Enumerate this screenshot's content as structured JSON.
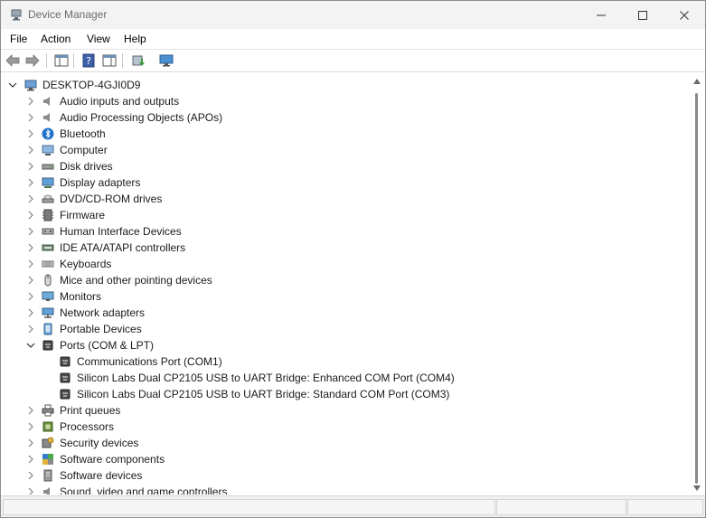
{
  "window": {
    "title": "Device Manager"
  },
  "menu": {
    "items": [
      "File",
      "Action",
      "View",
      "Help"
    ]
  },
  "toolbar": {
    "buttons": [
      "back-icon",
      "forward-icon",
      "properties-view-icon",
      "help-icon",
      "console-tree-icon",
      "update-driver-icon",
      "scan-hardware-icon"
    ]
  },
  "tree": {
    "root": "DESKTOP-4GJI0D9",
    "categories": [
      "Audio inputs and outputs",
      "Audio Processing Objects (APOs)",
      "Bluetooth",
      "Computer",
      "Disk drives",
      "Display adapters",
      "DVD/CD-ROM drives",
      "Firmware",
      "Human Interface Devices",
      "IDE ATA/ATAPI controllers",
      "Keyboards",
      "Mice and other pointing devices",
      "Monitors",
      "Network adapters",
      "Portable Devices",
      "Ports (COM & LPT)",
      "Print queues",
      "Processors",
      "Security devices",
      "Software components",
      "Software devices",
      "Sound, video and game controllers"
    ],
    "ports_children": [
      "Communications Port (COM1)",
      "Silicon Labs Dual CP2105 USB to UART Bridge: Enhanced COM Port (COM4)",
      "Silicon Labs Dual CP2105 USB to UART Bridge: Standard COM Port (COM3)"
    ]
  }
}
